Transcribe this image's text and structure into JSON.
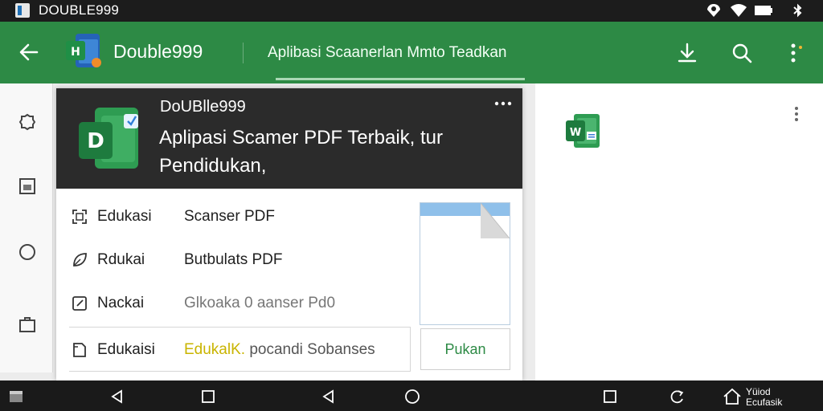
{
  "status_bar": {
    "title": "DOUBLE999"
  },
  "app_bar": {
    "app_name": "Double999",
    "tab_label": "Aplibasi Scaanerlan Mmto Teadkan"
  },
  "card": {
    "name": "DoUBlle999",
    "description": "Aplipasi Scamer PDF Terbaik, tur Pendidukan,",
    "rows": [
      {
        "label": "Edukasi",
        "value": "Scanser PDF",
        "icon": "scan-icon"
      },
      {
        "label": "Rdukai",
        "value": "Butbulats PDF",
        "icon": "leaf-icon"
      },
      {
        "label": "Nackai",
        "value": "Glkoaka 0 aanser Pd0",
        "icon": "edit-icon"
      },
      {
        "label": "Edukaisi",
        "value_highlight": "EdukalK.",
        "value_rest": " pocandi Sobanses",
        "icon": "document-icon"
      }
    ],
    "button_label": "Pukan"
  },
  "nav_bar": {
    "text_line1": "Yüiod",
    "text_line2": "Ecufasik"
  },
  "colors": {
    "app_bar": "#2d8a45",
    "card_header": "#2b2b2b",
    "status_bar": "#1c1c1c",
    "highlight": "#c9b400"
  }
}
